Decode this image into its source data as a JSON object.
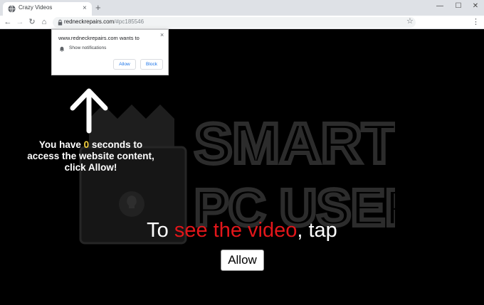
{
  "browser": {
    "tab_title": "Crazy Videos",
    "tab_close": "×",
    "new_tab": "+",
    "window_controls": {
      "minimize": "—",
      "maximize": "☐",
      "close": "✕"
    },
    "nav": {
      "back": "←",
      "forward": "→",
      "reload": "↻",
      "home": "⌂"
    },
    "url_host": "redneckrepairs.com",
    "url_path": "/#pc185546",
    "star": "☆",
    "menu": "⋮"
  },
  "popup": {
    "title": "www.redneckrepairs.com wants to",
    "permission": "Show notifications",
    "close": "×",
    "allow_label": "Allow",
    "block_label": "Block"
  },
  "content": {
    "countdown": {
      "before": "You have ",
      "seconds": "0",
      "after_line1": " seconds to",
      "line2": "access the website content,",
      "line3": "click Allow!"
    },
    "tap": {
      "before": "To ",
      "highlight": "see the video",
      "after": ", tap"
    },
    "allow_button": "Allow",
    "watermark": {
      "line1": "SMART",
      "line2": "PC USER"
    }
  },
  "colors": {
    "highlight_red": "#e3161a",
    "countdown_yellow": "#f4d03f",
    "link_blue": "#1a73e8"
  }
}
